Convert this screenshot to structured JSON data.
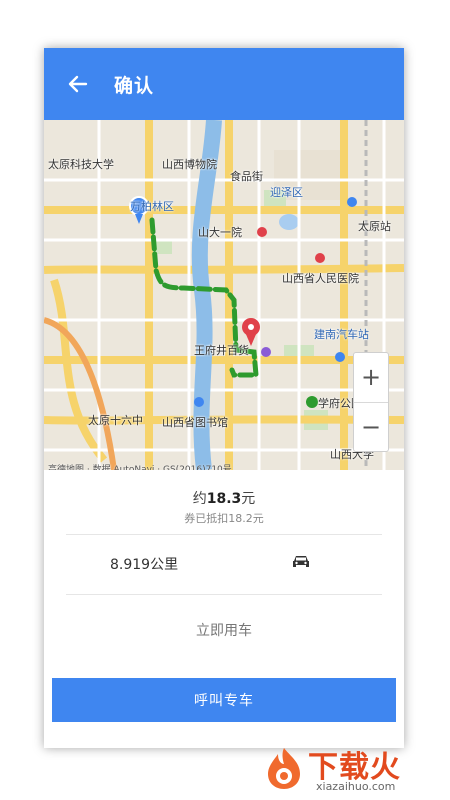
{
  "header": {
    "title": "确认",
    "back_icon": "arrow-left-icon"
  },
  "map": {
    "labels": {
      "l1": "太原科技大学",
      "l2": "山西博物院",
      "l3": "食品街",
      "l4": "迎泽区",
      "l5": "太原站",
      "l6": "万柏林区",
      "l7": "山大一院",
      "l8": "山西省人民医院",
      "l9": "建南汽车站",
      "l10": "王府井百货",
      "l11": "学府公园",
      "l12": "太原十六中",
      "l13": "山西省图书馆",
      "l14": "山西大学"
    },
    "copyright": "高德地图 · 数据 AutoNavi · GS(2016)710号",
    "zoom_in": "+",
    "zoom_out": "−"
  },
  "trip": {
    "price_prefix": "约",
    "price_value": "18.3",
    "price_unit": "元",
    "discount_prefix": "券已抵扣",
    "discount_value": "18.2",
    "discount_unit": "元",
    "distance": "8.919公里",
    "ride_now": "立即用车",
    "call_button": "呼叫专车"
  },
  "watermark": {
    "title": "下载火",
    "subtitle": "xiazaihuo.com"
  },
  "colors": {
    "primary": "#3f86f0",
    "route": "#2e9b2e",
    "marker": "#e0414a",
    "watermark": "#e24a1e"
  }
}
